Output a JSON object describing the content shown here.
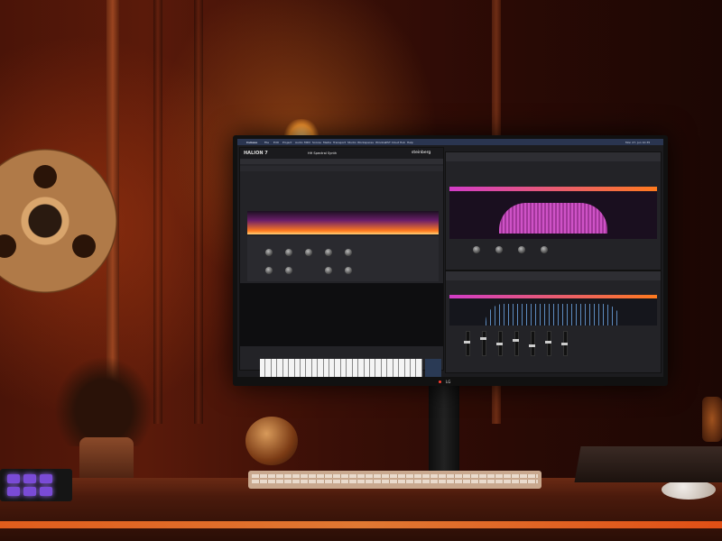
{
  "scene": {
    "kind": "photo of a music studio desk with a monitor showing a software synthesizer"
  },
  "menubar": {
    "app_name": "Cubase",
    "items": [
      "Cubase",
      "File",
      "Edit",
      "Project",
      "Audio",
      "MIDI",
      "Scores",
      "Media",
      "Transport",
      "Studio",
      "Workspaces",
      "Window",
      "VST Cloud",
      "Hub",
      "Help"
    ],
    "clock": "Mon 27. Jun 10:35"
  },
  "plugin": {
    "logo": "HALION 7",
    "brand": "steinberg",
    "preset_name": "HH Spectral Synth"
  },
  "colors": {
    "menubar": "#2a3550",
    "spectrum_orange": "#ff7a1e",
    "spectrum_magenta": "#d23cc8",
    "spectrum_blue": "#6fa8e8",
    "monitor_led": "#ff3b2f"
  },
  "monitor": {
    "brand": "LG"
  }
}
